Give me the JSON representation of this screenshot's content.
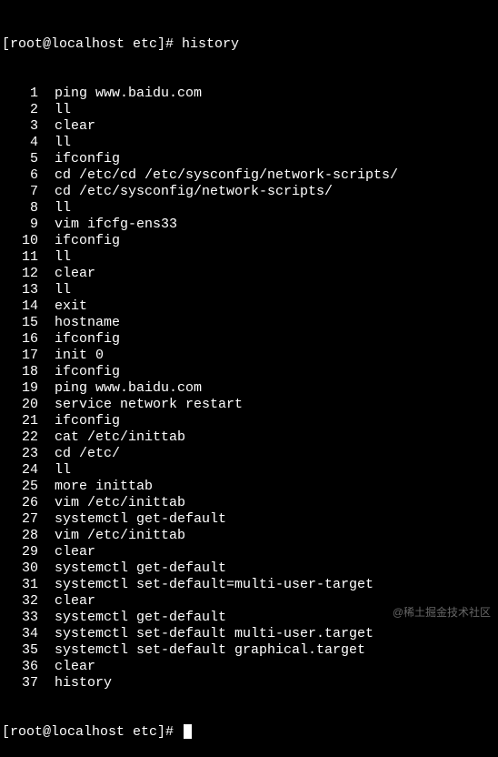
{
  "prompt_top": {
    "user_host": "[root@localhost etc]#",
    "command": "history"
  },
  "history": [
    {
      "n": "1",
      "cmd": "ping www.baidu.com"
    },
    {
      "n": "2",
      "cmd": "ll"
    },
    {
      "n": "3",
      "cmd": "clear"
    },
    {
      "n": "4",
      "cmd": "ll"
    },
    {
      "n": "5",
      "cmd": "ifconfig"
    },
    {
      "n": "6",
      "cmd": "cd /etc/cd /etc/sysconfig/network-scripts/"
    },
    {
      "n": "7",
      "cmd": "cd /etc/sysconfig/network-scripts/"
    },
    {
      "n": "8",
      "cmd": "ll"
    },
    {
      "n": "9",
      "cmd": "vim ifcfg-ens33"
    },
    {
      "n": "10",
      "cmd": "ifconfig"
    },
    {
      "n": "11",
      "cmd": "ll"
    },
    {
      "n": "12",
      "cmd": "clear"
    },
    {
      "n": "13",
      "cmd": "ll"
    },
    {
      "n": "14",
      "cmd": "exit"
    },
    {
      "n": "15",
      "cmd": "hostname"
    },
    {
      "n": "16",
      "cmd": "ifconfig"
    },
    {
      "n": "17",
      "cmd": "init 0"
    },
    {
      "n": "18",
      "cmd": "ifconfig"
    },
    {
      "n": "19",
      "cmd": "ping www.baidu.com"
    },
    {
      "n": "20",
      "cmd": "service network restart"
    },
    {
      "n": "21",
      "cmd": "ifconfig"
    },
    {
      "n": "22",
      "cmd": "cat /etc/inittab"
    },
    {
      "n": "23",
      "cmd": "cd /etc/"
    },
    {
      "n": "24",
      "cmd": "ll"
    },
    {
      "n": "25",
      "cmd": "more inittab"
    },
    {
      "n": "26",
      "cmd": "vim /etc/inittab"
    },
    {
      "n": "27",
      "cmd": "systemctl get-default"
    },
    {
      "n": "28",
      "cmd": "vim /etc/inittab"
    },
    {
      "n": "29",
      "cmd": "clear"
    },
    {
      "n": "30",
      "cmd": "systemctl get-default"
    },
    {
      "n": "31",
      "cmd": "systemctl set-default=multi-user-target"
    },
    {
      "n": "32",
      "cmd": "clear"
    },
    {
      "n": "33",
      "cmd": "systemctl get-default"
    },
    {
      "n": "34",
      "cmd": "systemctl set-default multi-user.target"
    },
    {
      "n": "35",
      "cmd": "systemctl set-default graphical.target"
    },
    {
      "n": "36",
      "cmd": "clear"
    },
    {
      "n": "37",
      "cmd": "history"
    }
  ],
  "prompt_bottom": {
    "user_host": "[root@localhost etc]#"
  },
  "watermark": "@稀土掘金技术社区"
}
